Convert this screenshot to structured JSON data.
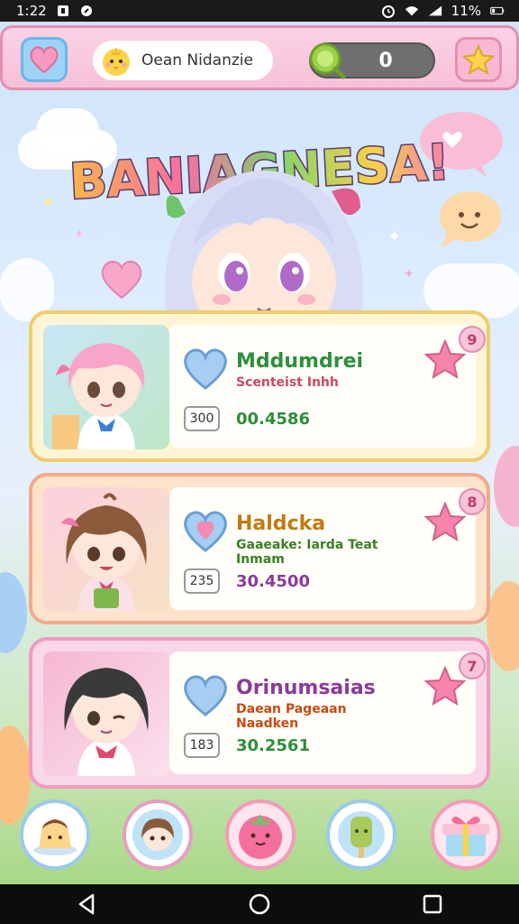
{
  "status_bar": {
    "time": "1:22",
    "battery_text": "11%"
  },
  "hud": {
    "player_name": "Oean Nidanzie",
    "currency_value": "0"
  },
  "title": "BANIAGNESA!",
  "cards": [
    {
      "name": "Mddumdrei",
      "subtitle": "Scenteist Inhh",
      "level": "300",
      "score": "00.4586",
      "star_badge": "9",
      "hair": "#f7a6c9",
      "portrait_bg": "#bfe6c7"
    },
    {
      "name": "Haldcka",
      "subtitle": "Gaaeake: Iarda Teat Inmam",
      "level": "235",
      "score": "30.4500",
      "star_badge": "8",
      "hair": "#8a5a3a",
      "portrait_bg": "#fbd0de"
    },
    {
      "name": "Orinumsaias",
      "subtitle": "Daean Pageaan Naadken",
      "level": "183",
      "score": "30.2561",
      "star_badge": "7",
      "hair": "#3a3a3a",
      "portrait_bg": "#f5b8d2"
    }
  ],
  "bottom_nav": [
    {
      "icon": "pudding-icon"
    },
    {
      "icon": "character-icon"
    },
    {
      "icon": "strawberry-icon"
    },
    {
      "icon": "popsicle-icon"
    },
    {
      "icon": "gift-box-icon"
    }
  ],
  "colors": {
    "hud_pink": "#f7c0d6",
    "card_gold": "#f0cc6a",
    "card_peach": "#f2a98d",
    "card_pink": "#f29ac0"
  }
}
